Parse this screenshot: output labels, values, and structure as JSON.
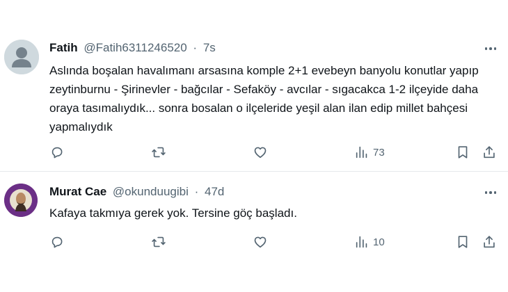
{
  "tweets": [
    {
      "name": "Fatih",
      "handle": "@Fatih6311246520",
      "separator": "·",
      "time": "7s",
      "text": "Aslında boşalan havalımanı arsasına komple 2+1 evebeyn banyolu konutlar yapıp zeytinburnu - Şirinevler - bağcılar - Sefaköy - avcılar - sıgacakca 1-2 ilçeyide daha oraya tasımalıydık... sonra bosalan o ilçeleride yeşil alan ilan edip millet bahçesi yapmalıydık",
      "views": "73"
    },
    {
      "name": "Murat Cae",
      "handle": "@okunduugibi",
      "separator": "·",
      "time": "47d",
      "text": "Kafaya takmıya gerek yok. Tersine göç başladı.",
      "views": "10"
    }
  ],
  "icons": {
    "reply": "reply-icon",
    "retweet": "retweet-icon",
    "like": "like-icon",
    "views": "views-icon",
    "bookmark": "bookmark-icon",
    "share": "share-icon",
    "more": "more-icon"
  },
  "colors": {
    "text": "#0f1419",
    "secondary": "#536471",
    "divider": "#e6e9ec",
    "default_avatar": "#cfd9de"
  }
}
